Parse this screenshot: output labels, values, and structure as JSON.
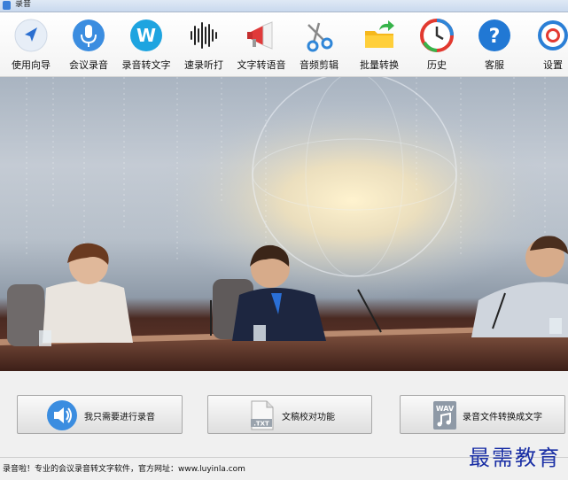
{
  "window": {
    "title": "录音"
  },
  "toolbar": {
    "items": [
      {
        "label": "使用向导",
        "icon": "navigation-arrow-icon"
      },
      {
        "label": "会议录音",
        "icon": "microphone-icon"
      },
      {
        "label": "录音转文字",
        "icon": "w-badge-icon"
      },
      {
        "label": "速录听打",
        "icon": "sound-wave-icon"
      },
      {
        "label": "文字转语音",
        "icon": "megaphone-icon"
      },
      {
        "label": "音频剪辑",
        "icon": "scissors-icon"
      },
      {
        "label": "批量转换",
        "icon": "folder-arrow-icon"
      },
      {
        "label": "历史",
        "icon": "history-clock-icon"
      },
      {
        "label": "客服",
        "icon": "help-question-icon"
      },
      {
        "label": "设置",
        "icon": "lifebuoy-icon"
      }
    ]
  },
  "banner": {
    "image": "business-meeting-banner"
  },
  "actions": {
    "record_label": "我只需要进行录音",
    "proofread_label": "文稿校对功能",
    "convert_label": "录音文件转换成文字",
    "txt_badge": ".TXT",
    "wav_badge": "WAV"
  },
  "status": {
    "text": "录音啦！专业的会议录音转文字软件，官方网址：www.luyinla.com",
    "watermark": "最需教育"
  },
  "colors": {
    "accent": "#3b8de0",
    "watermark": "#1a2fa5"
  }
}
